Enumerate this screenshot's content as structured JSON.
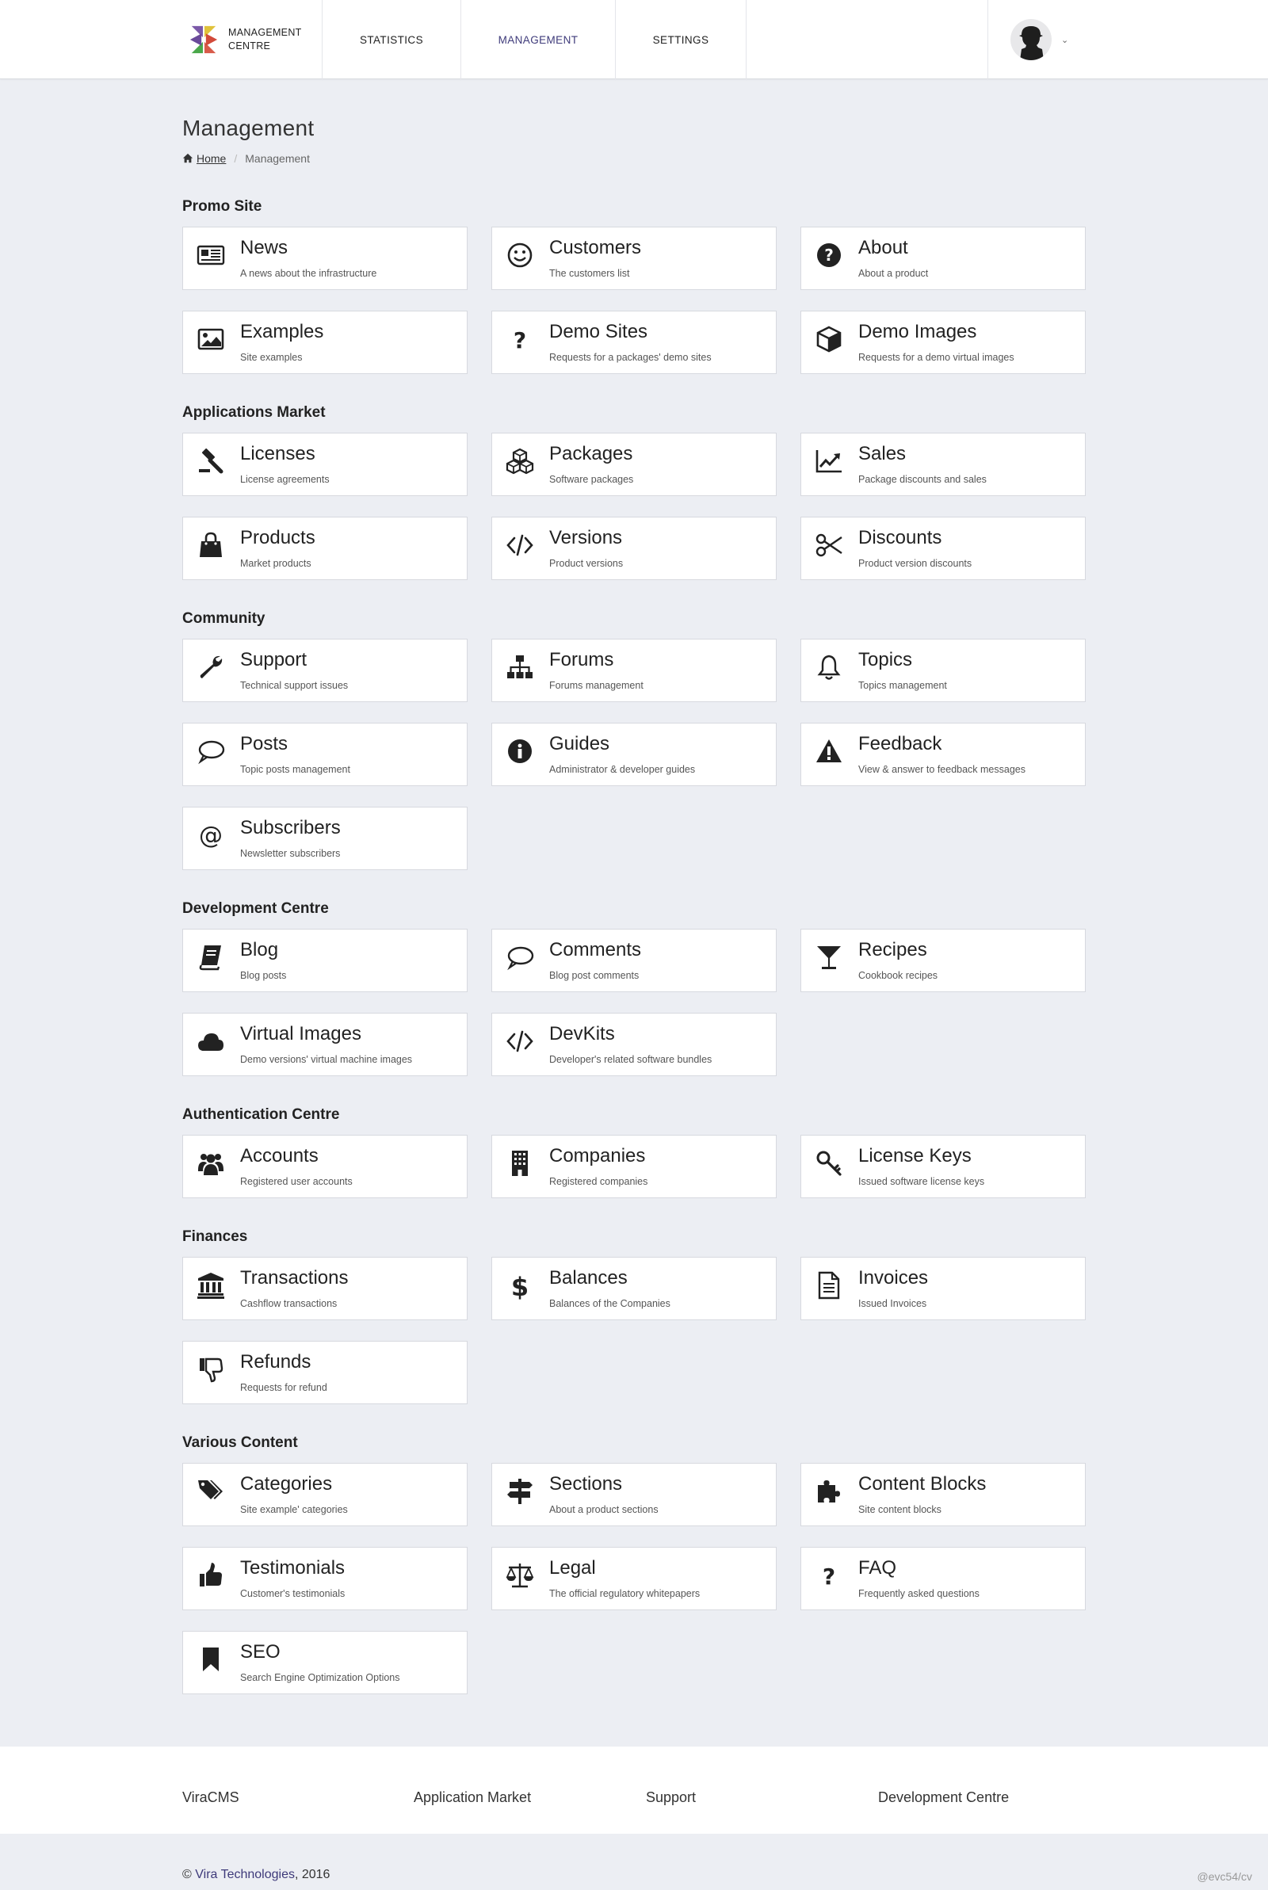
{
  "header": {
    "logo_line1": "MANAGEMENT",
    "logo_line2": "CENTRE",
    "nav": [
      {
        "label": "STATISTICS"
      },
      {
        "label": "MANAGEMENT"
      },
      {
        "label": "SETTINGS"
      }
    ],
    "active_nav": "MANAGEMENT",
    "caret": "⌄"
  },
  "page": {
    "title": "Management",
    "breadcrumb_home": "Home",
    "breadcrumb_sep": "/",
    "breadcrumb_current": "Management"
  },
  "sections": [
    {
      "title": "Promo Site",
      "cards": [
        {
          "title": "News",
          "desc": "A news about the infrastructure",
          "icon": "newspaper-icon"
        },
        {
          "title": "Customers",
          "desc": "The customers list",
          "icon": "smile-icon"
        },
        {
          "title": "About",
          "desc": "About a product",
          "icon": "question-circle-icon"
        },
        {
          "title": "Examples",
          "desc": "Site examples",
          "icon": "image-icon"
        },
        {
          "title": "Demo Sites",
          "desc": "Requests for a packages' demo sites",
          "icon": "question-icon"
        },
        {
          "title": "Demo Images",
          "desc": "Requests for a demo virtual images",
          "icon": "cube-icon"
        }
      ]
    },
    {
      "title": "Applications Market",
      "cards": [
        {
          "title": "Licenses",
          "desc": "License agreements",
          "icon": "gavel-icon"
        },
        {
          "title": "Packages",
          "desc": "Software packages",
          "icon": "cubes-icon"
        },
        {
          "title": "Sales",
          "desc": "Package discounts and sales",
          "icon": "line-chart-icon"
        },
        {
          "title": "Products",
          "desc": "Market products",
          "icon": "shopping-bag-icon"
        },
        {
          "title": "Versions",
          "desc": "Product versions",
          "icon": "code-icon"
        },
        {
          "title": "Discounts",
          "desc": "Product version discounts",
          "icon": "scissors-icon"
        }
      ]
    },
    {
      "title": "Community",
      "cards": [
        {
          "title": "Support",
          "desc": "Technical support issues",
          "icon": "wrench-icon"
        },
        {
          "title": "Forums",
          "desc": "Forums management",
          "icon": "sitemap-icon"
        },
        {
          "title": "Topics",
          "desc": "Topics management",
          "icon": "bell-icon"
        },
        {
          "title": "Posts",
          "desc": "Topic posts management",
          "icon": "comment-icon"
        },
        {
          "title": "Guides",
          "desc": "Administrator & developer guides",
          "icon": "info-circle-icon"
        },
        {
          "title": "Feedback",
          "desc": "View & answer to feedback messages",
          "icon": "warning-icon"
        },
        {
          "title": "Subscribers",
          "desc": "Newsletter subscribers",
          "icon": "at-icon"
        }
      ]
    },
    {
      "title": "Development Centre",
      "cards": [
        {
          "title": "Blog",
          "desc": "Blog posts",
          "icon": "book-icon"
        },
        {
          "title": "Comments",
          "desc": "Blog post comments",
          "icon": "comment-icon"
        },
        {
          "title": "Recipes",
          "desc": "Cookbook recipes",
          "icon": "glass-icon"
        },
        {
          "title": "Virtual Images",
          "desc": "Demo versions' virtual machine images",
          "icon": "cloud-icon"
        },
        {
          "title": "DevKits",
          "desc": "Developer's related software bundles",
          "icon": "code-icon"
        }
      ]
    },
    {
      "title": "Authentication Centre",
      "cards": [
        {
          "title": "Accounts",
          "desc": "Registered user accounts",
          "icon": "users-icon"
        },
        {
          "title": "Companies",
          "desc": "Registered companies",
          "icon": "building-icon"
        },
        {
          "title": "License Keys",
          "desc": "Issued software license keys",
          "icon": "key-icon"
        }
      ]
    },
    {
      "title": "Finances",
      "cards": [
        {
          "title": "Transactions",
          "desc": "Cashflow transactions",
          "icon": "bank-icon"
        },
        {
          "title": "Balances",
          "desc": "Balances of the Companies",
          "icon": "dollar-icon"
        },
        {
          "title": "Invoices",
          "desc": "Issued Invoices",
          "icon": "file-text-icon"
        },
        {
          "title": "Refunds",
          "desc": "Requests for refund",
          "icon": "thumbs-down-icon"
        }
      ]
    },
    {
      "title": "Various Content",
      "cards": [
        {
          "title": "Categories",
          "desc": "Site example' categories",
          "icon": "tags-icon"
        },
        {
          "title": "Sections",
          "desc": "About a product sections",
          "icon": "signpost-icon"
        },
        {
          "title": "Content Blocks",
          "desc": "Site content blocks",
          "icon": "puzzle-icon"
        },
        {
          "title": "Testimonials",
          "desc": "Customer's testimonials",
          "icon": "thumbs-up-icon"
        },
        {
          "title": "Legal",
          "desc": "The official regulatory whitepapers",
          "icon": "balance-scale-icon"
        },
        {
          "title": "FAQ",
          "desc": "Frequently asked questions",
          "icon": "question-icon"
        },
        {
          "title": "SEO",
          "desc": "Search Engine Optimization Options",
          "icon": "bookmark-icon"
        }
      ]
    }
  ],
  "footer": {
    "links": [
      {
        "label": "ViraCMS"
      },
      {
        "label": "Application Market"
      },
      {
        "label": "Support"
      },
      {
        "label": "Development Centre"
      }
    ],
    "copyright_symbol": "©",
    "company": "Vira Technologies",
    "year": ", 2016",
    "build": "@evc54/cv"
  },
  "colors": {
    "accent": "#3e3a7a",
    "background": "#eceef3",
    "card_border": "#d7d9df"
  }
}
